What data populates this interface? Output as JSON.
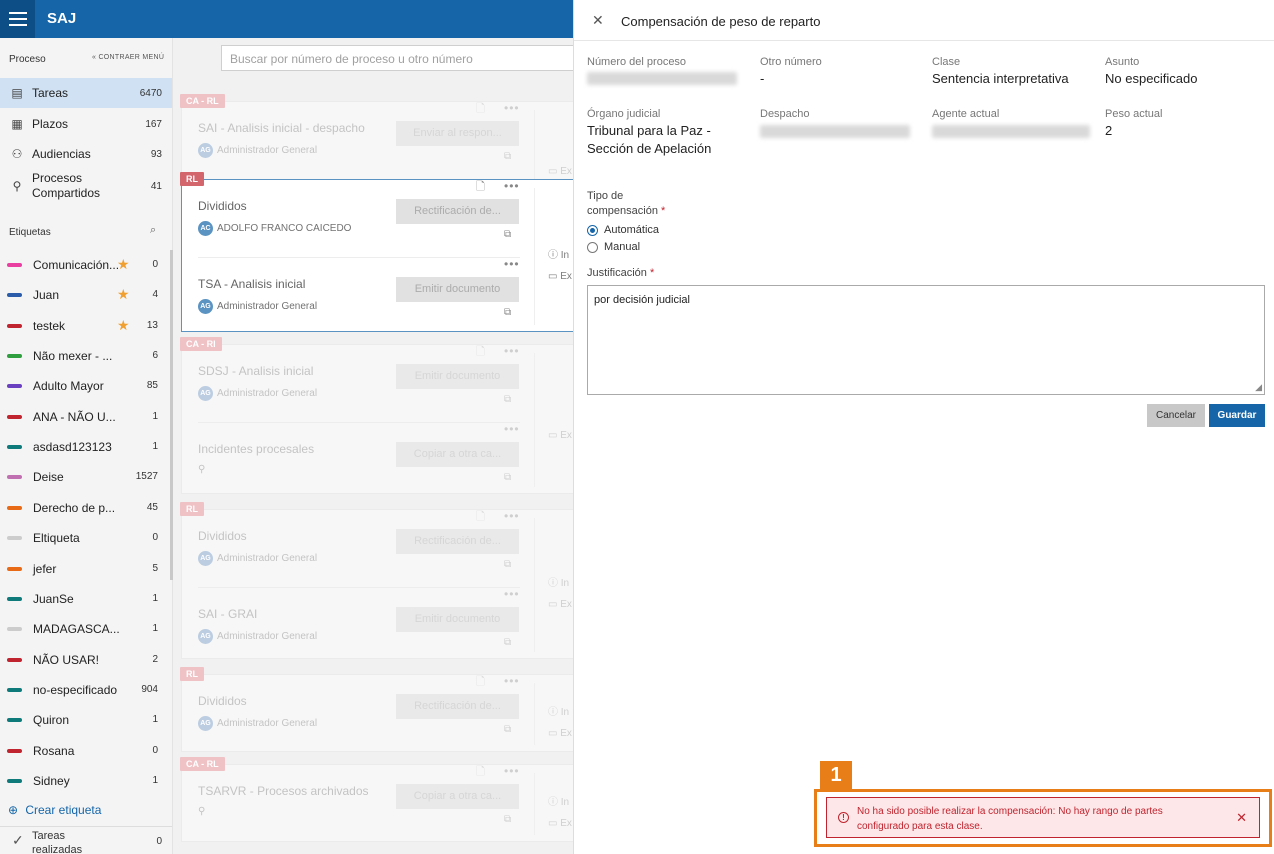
{
  "app": {
    "brand": "SAJ"
  },
  "sidebar": {
    "process_header": "Proceso",
    "collapse_label": "« CONTRAER MENÚ",
    "nav": [
      {
        "label": "Tareas",
        "count": "6470",
        "icon": "tasks-icon"
      },
      {
        "label": "Plazos",
        "count": "167",
        "icon": "calendar-icon"
      },
      {
        "label": "Audiencias",
        "count": "93",
        "icon": "people-icon"
      },
      {
        "label": "Procesos Compartidos",
        "count": "41",
        "icon": "shared-icon"
      }
    ],
    "labels_header": "Etiquetas",
    "tags": [
      {
        "name": "Comunicación...",
        "count": "0",
        "color": "#e83fa0",
        "starred": true
      },
      {
        "name": "Juan",
        "count": "4",
        "color": "#2a5caa",
        "starred": true
      },
      {
        "name": "testek",
        "count": "13",
        "color": "#c0242e",
        "starred": true
      },
      {
        "name": "Não mexer - ...",
        "count": "6",
        "color": "#2e9e3e",
        "starred": false
      },
      {
        "name": "Adulto Mayor",
        "count": "85",
        "color": "#6a3fc0",
        "starred": false
      },
      {
        "name": "ANA - NÃO U...",
        "count": "1",
        "color": "#c0242e",
        "starred": false
      },
      {
        "name": "asdasd123123",
        "count": "1",
        "color": "#0e7a7a",
        "starred": false
      },
      {
        "name": "Deise",
        "count": "1527",
        "color": "#c070b0",
        "starred": false
      },
      {
        "name": "Derecho de p...",
        "count": "45",
        "color": "#e86a17",
        "starred": false
      },
      {
        "name": "Eltiqueta",
        "count": "0",
        "color": "#cccccc",
        "starred": false
      },
      {
        "name": "jefer",
        "count": "5",
        "color": "#e86a17",
        "starred": false
      },
      {
        "name": "JuanSe",
        "count": "1",
        "color": "#0e7a7a",
        "starred": false
      },
      {
        "name": "MADAGASCA...",
        "count": "1",
        "color": "#cccccc",
        "starred": false
      },
      {
        "name": "NÃO USAR!",
        "count": "2",
        "color": "#c0242e",
        "starred": false
      },
      {
        "name": "no-especificado",
        "count": "904",
        "color": "#0e7a7a",
        "starred": false
      },
      {
        "name": "Quiron",
        "count": "1",
        "color": "#0e7a7a",
        "starred": false
      },
      {
        "name": "Rosana",
        "count": "0",
        "color": "#c0242e",
        "starred": false
      },
      {
        "name": "Sidney",
        "count": "1",
        "color": "#0e7a7a",
        "starred": false
      }
    ],
    "create_label": "Crear etiqueta",
    "done": {
      "label": "Tareas realizadas",
      "count": "0"
    }
  },
  "main": {
    "search_placeholder": "Buscar por número de proceso u otro número",
    "cards": [
      {
        "badge": "CA - RL",
        "tasks": [
          {
            "title": "SAI - Analisis inicial - despacho",
            "initials": "AG",
            "who": "Administrador General",
            "action": "Enviar al respon..."
          }
        ],
        "info": [
          "Ex"
        ]
      },
      {
        "badge": "RL",
        "tasks": [
          {
            "title": "Divididos",
            "initials": "AC",
            "who": "ADOLFO FRANCO CAICEDO",
            "action": "Rectificación de..."
          },
          {
            "title": "TSA - Analisis inicial",
            "initials": "AG",
            "who": "Administrador General",
            "action": "Emitir documento"
          }
        ],
        "info": [
          "In",
          "Ex"
        ]
      },
      {
        "badge": "CA - RI",
        "tasks": [
          {
            "title": "SDSJ - Analisis inicial",
            "initials": "AG",
            "who": "Administrador General",
            "action": "Emitir documento"
          },
          {
            "title": "Incidentes procesales",
            "initials": "",
            "who": "",
            "action": "Copiar a otra ca..."
          }
        ],
        "info": [
          "Ex"
        ]
      },
      {
        "badge": "RL",
        "tasks": [
          {
            "title": "Divididos",
            "initials": "AG",
            "who": "Administrador General",
            "action": "Rectificación de..."
          },
          {
            "title": "SAI - GRAI",
            "initials": "AG",
            "who": "Administrador General",
            "action": "Emitir documento"
          }
        ],
        "info": [
          "In",
          "Ex"
        ]
      },
      {
        "badge": "RL",
        "tasks": [
          {
            "title": "Divididos",
            "initials": "AG",
            "who": "Administrador General",
            "action": "Rectificación de..."
          }
        ],
        "info": [
          "In",
          "Ex"
        ]
      },
      {
        "badge": "CA - RL",
        "tasks": [
          {
            "title": "TSARVR - Procesos archivados",
            "initials": "",
            "who": "",
            "action": "Copiar a otra ca..."
          }
        ],
        "info": [
          "In",
          "Ex"
        ]
      }
    ]
  },
  "panel": {
    "title": "Compensación de peso de reparto",
    "fields": {
      "numero_label": "Número del proceso",
      "otro_label": "Otro número",
      "otro_value": "-",
      "clase_label": "Clase",
      "clase_value": "Sentencia interpretativa",
      "asunto_label": "Asunto",
      "asunto_value": "No especificado",
      "organo_label": "Órgano judicial",
      "organo_value_1": "Tribunal para la Paz -",
      "organo_value_2": "Sección de Apelación",
      "despacho_label": "Despacho",
      "agente_label": "Agente actual",
      "peso_label": "Peso actual",
      "peso_value": "2"
    },
    "tipo_label_1": "Tipo de",
    "tipo_label_2": "compensación",
    "options": [
      {
        "label": "Automática",
        "selected": true
      },
      {
        "label": "Manual",
        "selected": false
      }
    ],
    "justificacion_label": "Justificación",
    "justificacion_value": "por decisión judicial",
    "cancel_label": "Cancelar",
    "save_label": "Guardar"
  },
  "callout": {
    "number": "1"
  },
  "error": {
    "message": "No ha sido posible realizar la compensación: No hay rango de partes configurado para esta clase.",
    "accent": "#c0242e"
  },
  "colors": {
    "primary": "#1565a8",
    "callout": "#e87e17"
  }
}
